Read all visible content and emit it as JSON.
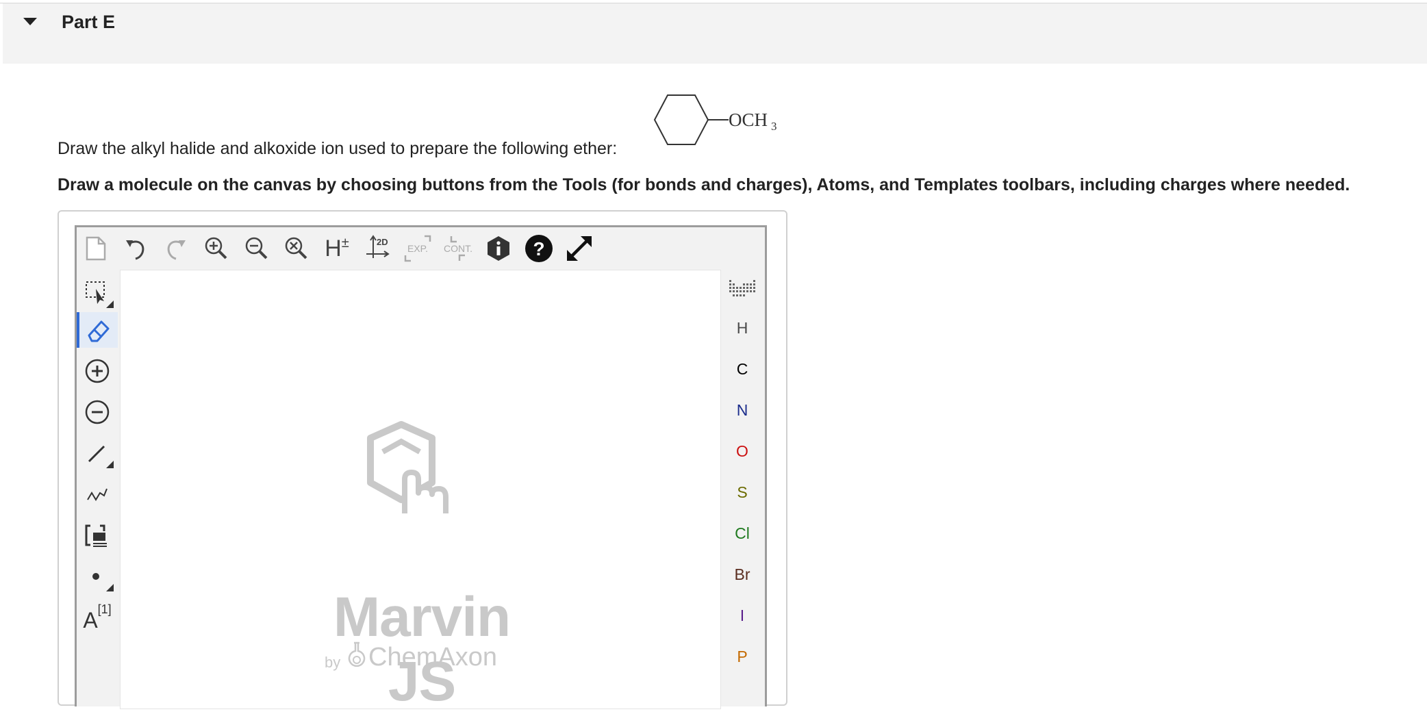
{
  "part": {
    "title": "Part E"
  },
  "question": {
    "prompt": "Draw the alkyl halide and alkoxide ion used to prepare the following ether:",
    "structure_label_main": "OCH",
    "structure_label_sub": "3",
    "instruction": "Draw a molecule on the canvas by choosing buttons from the Tools (for bonds and charges), Atoms, and Templates toolbars, including charges where needed."
  },
  "toolbar": {
    "h_label": "H",
    "h_sup": "±",
    "clean2d_label": "2D",
    "expand_label": "EXP.",
    "contract_label": "CONT."
  },
  "left_tools": {
    "text_tool_main": "A",
    "text_tool_sup": "[1]"
  },
  "atoms": [
    {
      "symbol": "H",
      "color": "#4a4a4a"
    },
    {
      "symbol": "C",
      "color": "#000000"
    },
    {
      "symbol": "N",
      "color": "#1c2d8c"
    },
    {
      "symbol": "O",
      "color": "#cc1111"
    },
    {
      "symbol": "S",
      "color": "#6b6b00"
    },
    {
      "symbol": "Cl",
      "color": "#1f7a1f"
    },
    {
      "symbol": "Br",
      "color": "#5a2d1f"
    },
    {
      "symbol": "I",
      "color": "#5b1f8c"
    },
    {
      "symbol": "P",
      "color": "#c46a00"
    }
  ],
  "watermark": {
    "title": "Marvin JS",
    "by": "by",
    "company": "ChemAxon"
  },
  "colors": {
    "accent": "#2f6ad6",
    "icon": "#555555"
  }
}
